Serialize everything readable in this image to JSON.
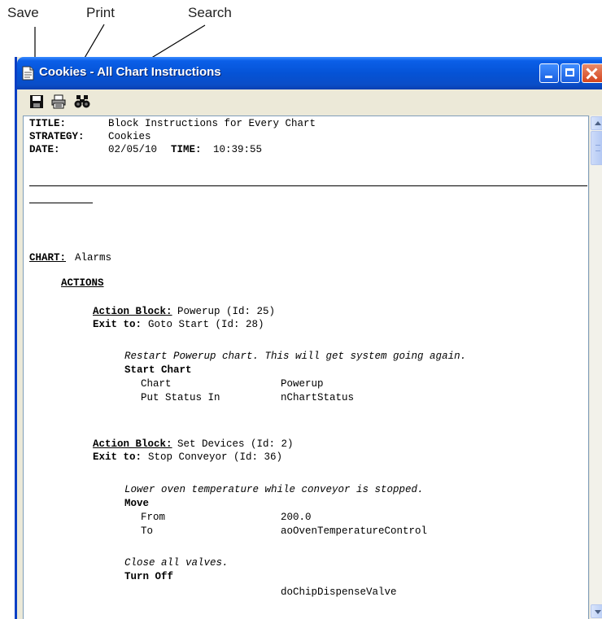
{
  "callouts": {
    "save": "Save",
    "print": "Print",
    "search": "Search"
  },
  "window": {
    "title": "Cookies - All Chart Instructions"
  },
  "toolbar": {
    "icons": [
      "save-icon",
      "print-icon",
      "binoculars-icon"
    ]
  },
  "header": {
    "title_label": "TITLE:",
    "title_value": "Block Instructions for Every Chart",
    "strategy_label": "STRATEGY:",
    "strategy_value": "Cookies",
    "date_label": "DATE:",
    "date_value": "02/05/10",
    "time_label": "TIME:",
    "time_value": "10:39:55"
  },
  "chart": {
    "label": "CHART:",
    "name": "Alarms",
    "actions_heading": "ACTIONS",
    "blocks": [
      {
        "block_label": "Action Block:",
        "block_value": "Powerup (Id: 25)",
        "exit_label": "Exit to:",
        "exit_value": "Goto Start (Id: 28)",
        "comment": "Restart Powerup chart. This will get system going again.",
        "command": "Start Chart",
        "params": [
          {
            "name": "Chart",
            "value": "Powerup"
          },
          {
            "name": "Put Status In",
            "value": "nChartStatus"
          }
        ]
      },
      {
        "block_label": "Action Block:",
        "block_value": "Set Devices (Id: 2)",
        "exit_label": "Exit to:",
        "exit_value": "Stop Conveyor (Id: 36)",
        "comment": "Lower oven temperature while conveyor is stopped.",
        "command": "Move",
        "params": [
          {
            "name": "From",
            "value": "200.0"
          },
          {
            "name": "To",
            "value": "aoOvenTemperatureControl"
          }
        ],
        "comment2": "Close all valves.",
        "command2": "Turn Off",
        "param2_value": "doChipDispenseValve"
      }
    ]
  },
  "colors": {
    "titlebar": "#0553d6",
    "window_bg": "#ece9d8",
    "close_button": "#d4441e"
  }
}
